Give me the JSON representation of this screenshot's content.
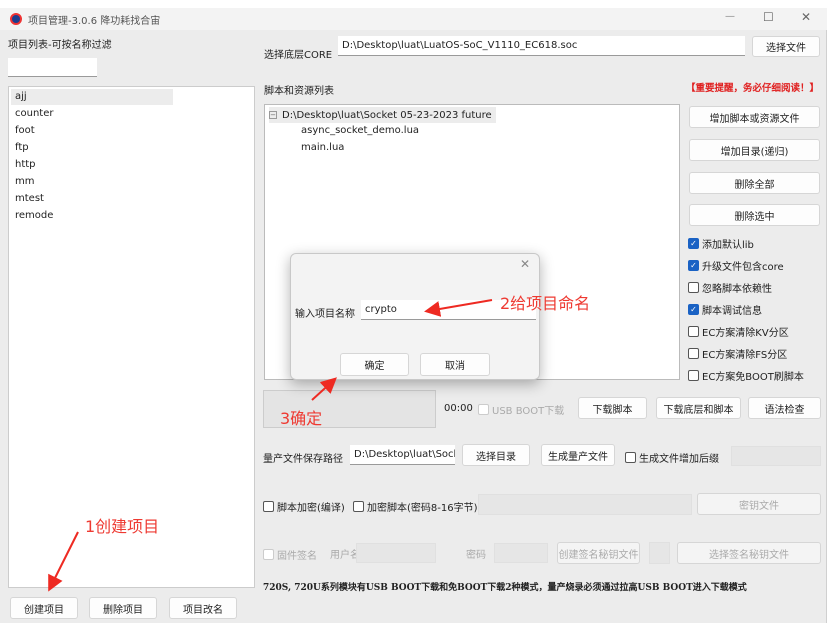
{
  "window": {
    "title": "项目管理-3.0.6 降功耗找合宙",
    "minimize": "—",
    "maximize": "☐",
    "close": "✕"
  },
  "left": {
    "filter_label": "项目列表-可按名称过滤",
    "filter_value": "",
    "projects": [
      "ajj",
      "counter",
      "foot",
      "ftp",
      "http",
      "mm",
      "mtest",
      "remode"
    ],
    "selected": "ajj",
    "create": "创建项目",
    "delete": "删除项目",
    "rename": "项目改名"
  },
  "core": {
    "label": "选择底层CORE",
    "path": "D:\\Desktop\\luat\\LuatOS-SoC_V1110_EC618.soc",
    "choose": "选择文件"
  },
  "scripts": {
    "label": "脚本和资源列表",
    "warning": "【重要提醒，务必仔细阅读！】",
    "root": "D:\\Desktop\\luat\\Socket 05-23-2023 future",
    "files": [
      "async_socket_demo.lua",
      "main.lua"
    ],
    "add_file": "增加脚本或资源文件",
    "add_dir": "增加目录(递归)",
    "delete_all": "删除全部",
    "delete_selected": "删除选中"
  },
  "options": [
    {
      "label": "添加默认lib",
      "checked": true
    },
    {
      "label": "升级文件包含core",
      "checked": true
    },
    {
      "label": "忽略脚本依赖性",
      "checked": false
    },
    {
      "label": "脚本调试信息",
      "checked": true
    },
    {
      "label": "EC方案清除KV分区",
      "checked": false
    },
    {
      "label": "EC方案清除FS分区",
      "checked": false
    },
    {
      "label": "EC方案免BOOT刷脚本",
      "checked": false
    }
  ],
  "download": {
    "time": "00:00",
    "usb_boot": "USB BOOT下载",
    "dl_script": "下载脚本",
    "dl_core_script": "下载底层和脚本",
    "syntax": "语法检查",
    "progress": 0
  },
  "production": {
    "label": "量产文件保存路径",
    "path": "D:\\Desktop\\luat\\Sock",
    "choose_dir": "选择目录",
    "generate": "生成量产文件",
    "suffix": "生成文件增加后缀"
  },
  "encrypt": {
    "compile": "脚本加密(编译)",
    "encrypt_pwd": "加密脚本(密码8-16字节)",
    "key_file": "密钥文件"
  },
  "sign": {
    "label": "固件签名",
    "user": "用户名",
    "password": "密码",
    "create_key": "创建签名秘钥文件",
    "select_key": "选择签名秘钥文件"
  },
  "note": "720S, 720U系列模块有USB  BOOT下载和免BOOT下载2种模式，量产烧录必须通过拉高USB  BOOT进入下载模式",
  "dialog": {
    "label": "输入项目名称",
    "value": "crypto",
    "ok": "确定",
    "cancel": "取消",
    "close": "✕"
  },
  "annotations": {
    "step1": "1创建项目",
    "step2": "2给项目命名",
    "step3": "3确定",
    "color": "#ee3a32"
  }
}
